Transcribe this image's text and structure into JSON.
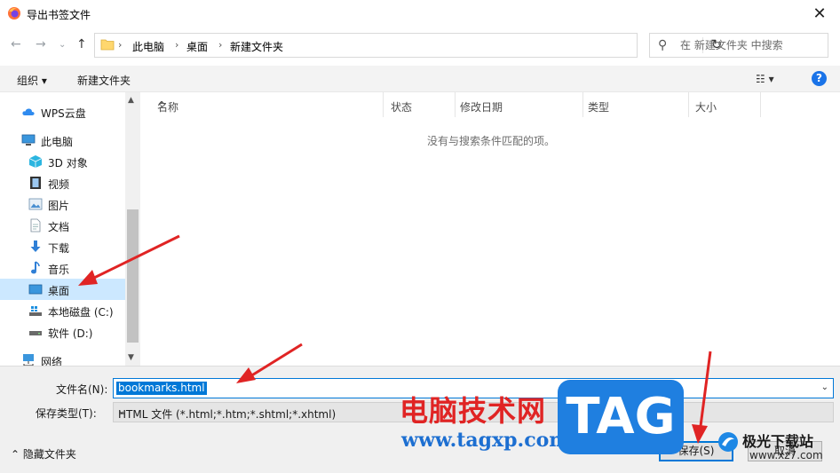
{
  "window": {
    "title": "导出书签文件",
    "close_glyph": "✕"
  },
  "nav": {
    "back_glyph": "←",
    "forward_glyph": "→",
    "dropdown_glyph": "⌄",
    "up_glyph": "↑"
  },
  "address": {
    "crumbs": [
      "此电脑",
      "桌面",
      "新建文件夹"
    ],
    "sep": "›",
    "dd_glyph": "⌄",
    "refresh_glyph": "↻"
  },
  "search": {
    "placeholder": "在 新建文件夹 中搜索",
    "icon_glyph": "⚲"
  },
  "toolbar": {
    "organize": "组织 ▾",
    "new_folder": "新建文件夹",
    "view_glyph": "☷ ▾",
    "help": "?"
  },
  "sidebar": {
    "items": [
      {
        "label": "WPS云盘",
        "icon": "cloud-icon"
      },
      {
        "label": "此电脑",
        "icon": "computer-icon"
      },
      {
        "label": "3D 对象",
        "icon": "cube-icon"
      },
      {
        "label": "视频",
        "icon": "video-icon"
      },
      {
        "label": "图片",
        "icon": "pictures-icon"
      },
      {
        "label": "文档",
        "icon": "document-icon"
      },
      {
        "label": "下载",
        "icon": "download-icon"
      },
      {
        "label": "音乐",
        "icon": "music-icon"
      },
      {
        "label": "桌面",
        "icon": "desktop-icon",
        "selected": true
      },
      {
        "label": "本地磁盘 (C:)",
        "icon": "drive-icon"
      },
      {
        "label": "软件 (D:)",
        "icon": "drive-icon"
      },
      {
        "label": "网络",
        "icon": "network-icon"
      }
    ],
    "scroll_up": "▲",
    "scroll_down": "▼"
  },
  "files": {
    "columns": [
      "名称",
      "状态",
      "修改日期",
      "类型",
      "大小"
    ],
    "sort_glyph": "^",
    "empty_message": "没有与搜索条件匹配的项。"
  },
  "footer": {
    "filename_label": "文件名(N):",
    "filename_value": "bookmarks.html",
    "filetype_label": "保存类型(T):",
    "filetype_value": "HTML 文件 (*.html;*.htm;*.shtml;*.xhtml)",
    "dd_glyph": "⌄",
    "hide_folders": "⌃  隐藏文件夹",
    "save": "保存(S)",
    "cancel": "取消"
  },
  "watermarks": {
    "site_cn": "电脑技术网",
    "site_url": "www.tagxp.com",
    "tag": "TAG",
    "xz_title": "极光下载站",
    "xz_url": "www.xz7.com"
  },
  "colors": {
    "accent": "#0078d7",
    "selection": "#cce8ff",
    "arrow": "#e02424"
  }
}
